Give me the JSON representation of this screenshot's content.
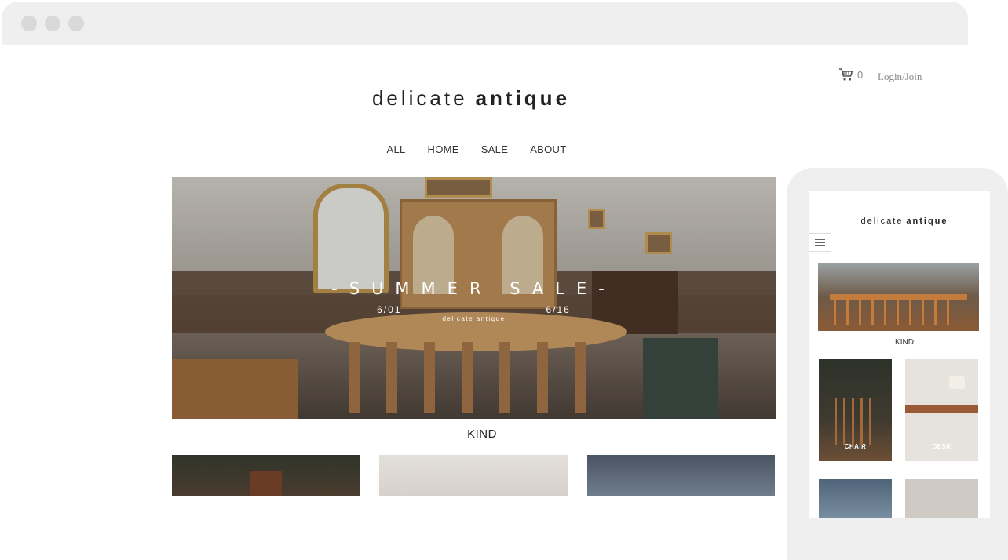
{
  "header": {
    "cart_count": "0",
    "login_label": "Login/Join",
    "logo_light": "delicate",
    "logo_bold": "antique"
  },
  "nav": {
    "items": [
      "ALL",
      "HOME",
      "SALE",
      "ABOUT"
    ]
  },
  "hero": {
    "title": "-SUMMER SALE-",
    "start_date": "6/01",
    "end_date": "6/16",
    "brand": "delicate antique"
  },
  "section_title": "KIND",
  "mobile": {
    "logo_light": "delicate",
    "logo_bold": "antique",
    "section_title": "KIND",
    "cards": [
      "CHAIR",
      "DESK"
    ]
  },
  "colors": {
    "text": "#222222",
    "muted": "#888888",
    "frame": "#efefef"
  },
  "icons": [
    "cart-icon",
    "hamburger-menu-icon"
  ]
}
